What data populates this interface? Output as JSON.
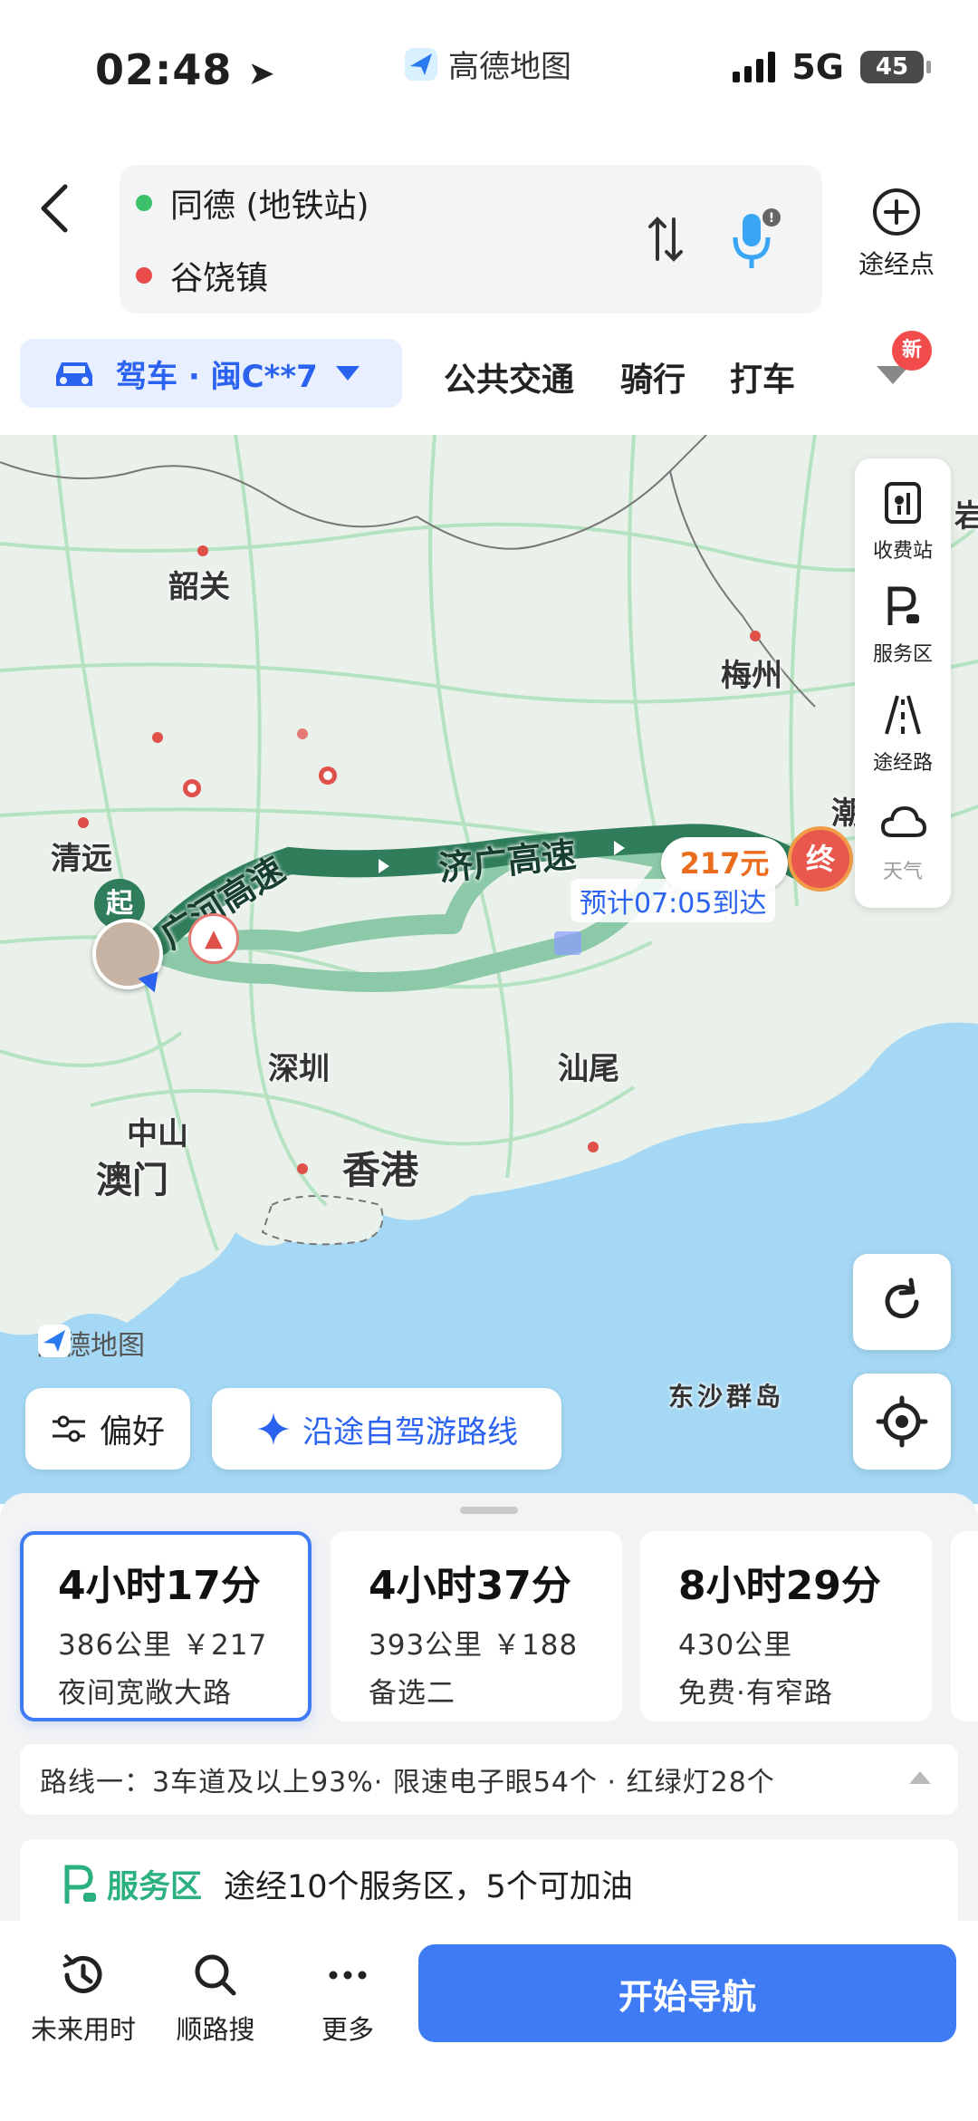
{
  "status_bar": {
    "time": "02:48",
    "app_name": "高德地图",
    "network": "5G",
    "battery": "45"
  },
  "route": {
    "origin": "同德 (地铁站)",
    "destination": "谷饶镇",
    "waypoint_label": "途经点"
  },
  "modes": {
    "drive": "驾车 · 闽C**7",
    "transit": "公共交通",
    "cycling": "骑行",
    "taxi": "打车",
    "new_badge": "新"
  },
  "map": {
    "cities": [
      "韶关",
      "梅州",
      "清远",
      "深圳",
      "汕尾",
      "中山",
      "澳门",
      "香港",
      "东沙群岛",
      "潮",
      "岩"
    ],
    "road_labels": [
      "广河高速",
      "济广高速"
    ],
    "start_marker": "起",
    "end_marker": "终",
    "toll_fee": "217元",
    "eta_text": "预计07:05到达",
    "watermark": "高德地图",
    "tools": [
      "收费站",
      "服务区",
      "途经路",
      "天气"
    ]
  },
  "actions": {
    "preference": "偏好",
    "trip_route": "沿途自驾游路线"
  },
  "options": [
    {
      "time": "4小时17分",
      "detail": "386公里 ￥217",
      "note": "夜间宽敞大路"
    },
    {
      "time": "4小时37分",
      "detail": "393公里 ￥188",
      "note": "备选二"
    },
    {
      "time": "8小时29分",
      "detail": "430公里",
      "note": "免费·有窄路"
    }
  ],
  "route_info": "路线一：3车道及以上93%· 限速电子眼54个 · 红绿灯28个",
  "service_area": {
    "label": "服务区",
    "text": "途经10个服务区，5个可加油"
  },
  "bottom_nav": {
    "future_time": "未来用时",
    "along_search": "顺路搜",
    "more": "更多",
    "start": "开始导航"
  },
  "colors": {
    "accent": "#3f7bf5",
    "route_primary": "#2f7d5a",
    "route_alt": "#8cc9a8",
    "sea": "#a4d8f4",
    "land": "#e9f1ea"
  }
}
